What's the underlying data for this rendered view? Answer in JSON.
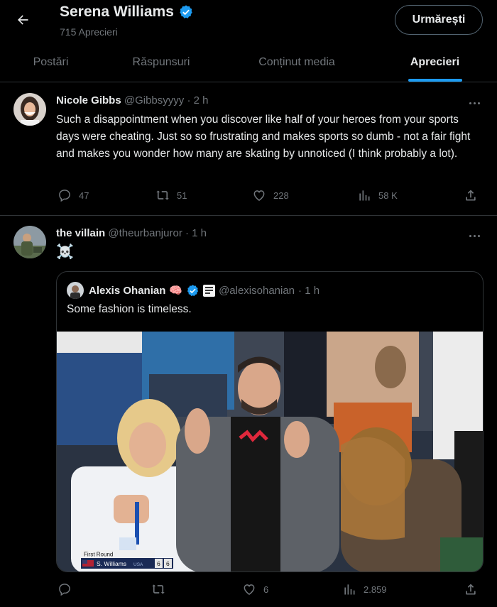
{
  "header": {
    "title": "Serena Williams",
    "subtitle": "715 Aprecieri",
    "follow_label": "Urmărești"
  },
  "tabs": [
    {
      "label": "Postări",
      "active": false
    },
    {
      "label": "Răspunsuri",
      "active": false
    },
    {
      "label": "Conținut media",
      "active": false
    },
    {
      "label": "Aprecieri",
      "active": true
    }
  ],
  "tweet1": {
    "name": "Nicole Gibbs",
    "handle": "@Gibbsyyyy",
    "time": "· 2 h",
    "text": "Such a disappointment when you discover like half of your heroes from your sports days were cheating. Just so so frustrating and makes sports so dumb - not a fair fight and makes you wonder how many are skating by unnoticed (I think probably a lot).",
    "replies": "47",
    "reposts": "51",
    "likes": "228",
    "views": "58 K"
  },
  "tweet2": {
    "name": "the villain",
    "handle": "@theurbanjuror",
    "time": "· 1 h",
    "text": "☠️",
    "replies": "",
    "reposts": "",
    "likes": "6",
    "views": "2.859",
    "quote": {
      "name": "Alexis Ohanian",
      "emoji": "🧠",
      "handle": "@alexisohanian",
      "time": "· 1 h",
      "text": "Some fashion is timeless.",
      "scoreboard": {
        "round": "First Round",
        "player": "S. Williams",
        "country": "USA",
        "set1": "6",
        "set2": "6"
      }
    }
  },
  "colors": {
    "background": "#000000",
    "accent": "#1d9bf0",
    "text": "#e7e9ea",
    "muted": "#71767b",
    "border": "#2f3336"
  }
}
